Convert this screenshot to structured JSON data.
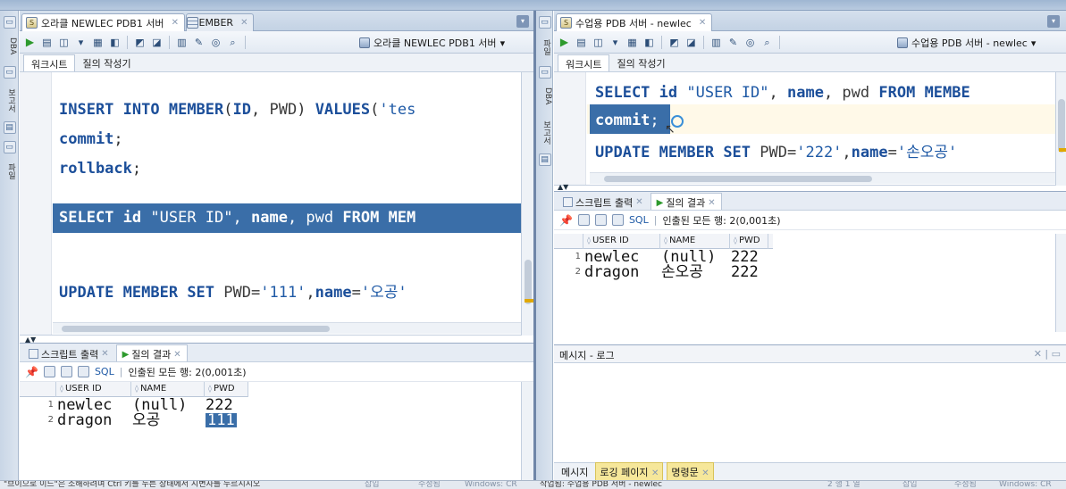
{
  "left": {
    "side_labels": [
      "DBA",
      "보고서",
      "파일"
    ],
    "tabs": [
      {
        "label": "오라클 NEWLEC PDB1 서버",
        "icon": "sql-worksheet-icon"
      },
      {
        "label": "MEMBER",
        "icon": "table-icon"
      }
    ],
    "connection": "오라클 NEWLEC PDB1 서버",
    "subtabs": [
      "워크시트",
      "질의 작성기"
    ],
    "code_lines": [
      {
        "tokens": [
          [
            "kw",
            "INSERT "
          ],
          [
            "kw",
            "INTO "
          ],
          [
            "kw",
            "MEMBER"
          ],
          [
            "sym",
            "("
          ],
          [
            "kw",
            "ID"
          ],
          [
            "sym",
            ", "
          ],
          [
            "id",
            "PWD"
          ],
          [
            "sym",
            ") "
          ],
          [
            "kw",
            "VALUES"
          ],
          [
            "sym",
            "("
          ],
          [
            "str",
            "'tes"
          ]
        ]
      },
      {
        "tokens": [
          [
            "kw",
            "commit"
          ],
          [
            "sym",
            ";"
          ]
        ]
      },
      {
        "tokens": [
          [
            "kw",
            "rollback"
          ],
          [
            "sym",
            ";"
          ]
        ]
      },
      {
        "tokens": []
      },
      {
        "tokens": [
          [
            "kw",
            "SELECT "
          ],
          [
            "kw",
            "id "
          ],
          [
            "str",
            "\"USER ID\""
          ],
          [
            "sym",
            ", "
          ],
          [
            "kw",
            "name"
          ],
          [
            "sym",
            ", "
          ],
          [
            "id",
            "pwd "
          ],
          [
            "kw",
            "FROM "
          ],
          [
            "kw",
            "MEM"
          ]
        ]
      },
      {
        "tokens": []
      },
      {
        "tokens": [
          [
            "kw",
            "UPDATE "
          ],
          [
            "kw",
            "MEMBER "
          ],
          [
            "kw",
            "SET "
          ],
          [
            "id",
            "PWD"
          ],
          [
            "sym",
            "="
          ],
          [
            "str",
            "'111'"
          ],
          [
            "sym",
            ","
          ],
          [
            "kw",
            "name"
          ],
          [
            "sym",
            "="
          ],
          [
            "str",
            "'오공'"
          ]
        ]
      }
    ],
    "results_tabs": [
      "스크립트 출력",
      "질의 결과"
    ],
    "sql_label": "SQL",
    "fetch_status": "인출된 모든 행: 2(0,001초)",
    "columns": [
      "USER ID",
      "NAME",
      "PWD"
    ],
    "rows": [
      {
        "n": "1",
        "user_id": "newlec",
        "name": "(null)",
        "pwd": "222"
      },
      {
        "n": "2",
        "user_id": "dragon",
        "name": "오공",
        "pwd": "111"
      }
    ]
  },
  "right": {
    "side_labels": [
      "DBA",
      "보고서",
      "파일"
    ],
    "tabs": [
      {
        "label": "수업용 PDB 서버 - newlec",
        "icon": "sql-worksheet-icon"
      }
    ],
    "connection": "수업용 PDB 서버 - newlec",
    "subtabs": [
      "워크시트",
      "질의 작성기"
    ],
    "code_lines": [
      {
        "tokens": [
          [
            "kw",
            "SELECT "
          ],
          [
            "kw",
            "id "
          ],
          [
            "str",
            "\"USER ID\""
          ],
          [
            "sym",
            ", "
          ],
          [
            "kw",
            "name"
          ],
          [
            "sym",
            ", "
          ],
          [
            "id",
            "pwd "
          ],
          [
            "kw",
            "FROM "
          ],
          [
            "kw",
            "MEMBE"
          ]
        ]
      },
      {
        "tokens": [
          [
            "kw",
            "commit"
          ],
          [
            "sym",
            ";"
          ]
        ]
      },
      {
        "tokens": [
          [
            "kw",
            "UPDATE "
          ],
          [
            "kw",
            "MEMBER "
          ],
          [
            "kw",
            "SET "
          ],
          [
            "id",
            "PWD"
          ],
          [
            "sym",
            "="
          ],
          [
            "str",
            "'222'"
          ],
          [
            "sym",
            ","
          ],
          [
            "kw",
            "name"
          ],
          [
            "sym",
            "="
          ],
          [
            "str",
            "'손오공'"
          ]
        ]
      }
    ],
    "results_tabs": [
      "스크립트 출력",
      "질의 결과"
    ],
    "sql_label": "SQL",
    "fetch_status": "인출된 모든 행: 2(0,001초)",
    "columns": [
      "USER ID",
      "NAME",
      "PWD"
    ],
    "rows": [
      {
        "n": "1",
        "user_id": "newlec",
        "name": "(null)",
        "pwd": "222"
      },
      {
        "n": "2",
        "user_id": "dragon",
        "name": "손오공",
        "pwd": "222"
      }
    ],
    "message_title": "메시지 - 로그",
    "message_tabs": [
      "메시지",
      "로깅 페이지",
      "명령문"
    ]
  },
  "status": {
    "left_text": "\"브이으로 이드\"은 소해하려며 Ctrl 키를 누른 상태에서 시변자를 누르시시오",
    "left_insert": "삽입",
    "left_mod": "수정됨",
    "left_os": "Windows: CR",
    "right_text": "작업됨: 수업용 PDB 서버 - newlec",
    "right_pos": "2 행 1 열",
    "right_insert": "삽입",
    "right_mod": "수정됨",
    "right_os": "Windows: CR"
  }
}
